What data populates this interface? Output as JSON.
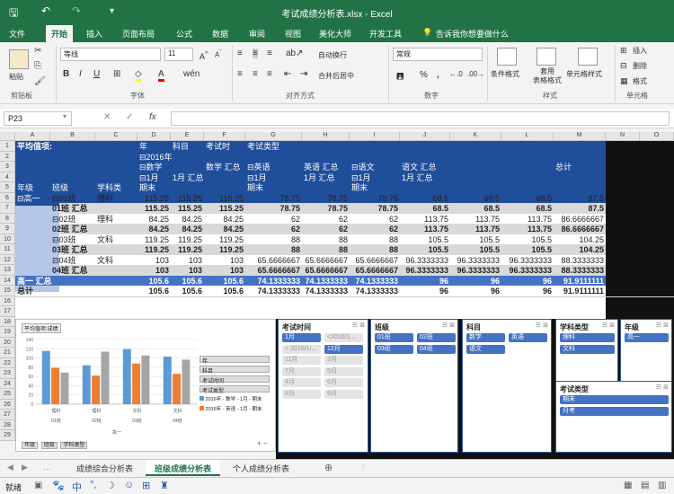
{
  "window": {
    "title": "考试成绩分析表.xlsx - Excel"
  },
  "ribbon_tabs": [
    "文件",
    "开始",
    "插入",
    "页面布局",
    "公式",
    "数据",
    "审阅",
    "视图",
    "美化大师",
    "开发工具"
  ],
  "tell_me": "告诉我你想要做什么",
  "ribbon": {
    "paste": "粘贴",
    "font_name": "等线",
    "font_size": "11",
    "wrap_text": "自动换行",
    "merge_center": "合并后居中",
    "number_format": "常规",
    "percent": "%",
    "cond_format": "条件格式",
    "table_format": "套用\n表格格式",
    "cell_style": "单元格样式",
    "insert": "插入",
    "delete": "删除",
    "format": "格式",
    "groups": [
      "剪贴板",
      "字体",
      "对齐方式",
      "数字",
      "样式",
      "单元格"
    ]
  },
  "formula_bar": {
    "name_box": "P23",
    "fx": "fx"
  },
  "columns": [
    "A",
    "B",
    "C",
    "D",
    "E",
    "F",
    "G",
    "H",
    "I",
    "J",
    "K",
    "L",
    "M",
    "N",
    "O"
  ],
  "rows": [
    "1",
    "2",
    "3",
    "4",
    "5",
    "6",
    "7",
    "8",
    "9",
    "10",
    "11",
    "12",
    "13",
    "14",
    "15",
    "16",
    "17",
    "18",
    "19",
    "20",
    "21",
    "22",
    "23",
    "24",
    "25",
    "26",
    "27",
    "28",
    "29"
  ],
  "pivot": {
    "r1": {
      "a": "平均值项:",
      "d": "年",
      "e": "科目",
      "f": "考试时",
      "g": "考试类型"
    },
    "r2": {
      "d": "⊟2016年"
    },
    "r3": {
      "d": "⊟数学",
      "f": "数学 汇总",
      "g": "⊟英语",
      "h": "英语 汇总",
      "i": "⊟语文",
      "j": "语文 汇总",
      "m": "总计"
    },
    "r4": {
      "d": "⊟1月",
      "e": "1月 汇总",
      "g": "⊟1月",
      "h": "1月 汇总",
      "i": "⊟1月",
      "j": "1月 汇总"
    },
    "r5": {
      "a": "年级",
      "b": "班级",
      "c": "学科类",
      "d": "期末",
      "g": "期末",
      "i": "期末"
    },
    "data": [
      {
        "a": "⊟高一",
        "b": "⊟01班",
        "c": "理科",
        "v": [
          "115.25",
          "115.25",
          "115.25",
          "78.75",
          "78.75",
          "78.75",
          "68.5",
          "68.5",
          "68.5",
          "87.5"
        ],
        "sum": false
      },
      {
        "a": "",
        "b": "01班 汇总",
        "c": "",
        "v": [
          "115.25",
          "115.25",
          "115.25",
          "78.75",
          "78.75",
          "78.75",
          "68.5",
          "68.5",
          "68.5",
          "87.5"
        ],
        "sum": true
      },
      {
        "a": "",
        "b": "⊟02班",
        "c": "理科",
        "v": [
          "84.25",
          "84.25",
          "84.25",
          "62",
          "62",
          "62",
          "113.75",
          "113.75",
          "113.75",
          "86.6666667"
        ],
        "sum": false
      },
      {
        "a": "",
        "b": "02班 汇总",
        "c": "",
        "v": [
          "84.25",
          "84.25",
          "84.25",
          "62",
          "62",
          "62",
          "113.75",
          "113.75",
          "113.75",
          "86.6666667"
        ],
        "sum": true
      },
      {
        "a": "",
        "b": "⊟03班",
        "c": "文科",
        "v": [
          "119.25",
          "119.25",
          "119.25",
          "88",
          "88",
          "88",
          "105.5",
          "105.5",
          "105.5",
          "104.25"
        ],
        "sum": false
      },
      {
        "a": "",
        "b": "03班 汇总",
        "c": "",
        "v": [
          "119.25",
          "119.25",
          "119.25",
          "88",
          "88",
          "88",
          "105.5",
          "105.5",
          "105.5",
          "104.25"
        ],
        "sum": true
      },
      {
        "a": "",
        "b": "⊟04班",
        "c": "文科",
        "v": [
          "103",
          "103",
          "103",
          "65.6666667",
          "65.6666667",
          "65.6666667",
          "96.3333333",
          "96.3333333",
          "96.3333333",
          "88.3333333"
        ],
        "sum": false
      },
      {
        "a": "",
        "b": "04班 汇总",
        "c": "",
        "v": [
          "103",
          "103",
          "103",
          "65.6666667",
          "65.6666667",
          "65.6666667",
          "96.3333333",
          "96.3333333",
          "96.3333333",
          "88.3333333"
        ],
        "sum": true
      },
      {
        "a": "高一 汇总",
        "b": "",
        "c": "",
        "v": [
          "105.6",
          "105.6",
          "105.6",
          "74.1333333",
          "74.1333333",
          "74.1333333",
          "96",
          "96",
          "96",
          "91.9111111"
        ],
        "sum": true,
        "band": true
      },
      {
        "a": "总计",
        "b": "",
        "c": "",
        "v": [
          "105.6",
          "105.6",
          "105.6",
          "74.1333333",
          "74.1333333",
          "74.1333333",
          "96",
          "96",
          "96",
          "91.9111111"
        ],
        "sum": true
      }
    ]
  },
  "chart": {
    "button_label": "平均值项:成绩",
    "bottom_buttons": [
      "年级",
      "班级",
      "学科类型"
    ],
    "fields": [
      "年",
      "科目",
      "考试时间",
      "考试类型"
    ],
    "legend": [
      "2016年 - 数学 - 1月 - 期末",
      "2016年 - 英语 - 1月 - 期末"
    ],
    "colors": [
      "#5b9bd5",
      "#ed7d31",
      "#a5a5a5"
    ]
  },
  "chart_data": {
    "type": "bar",
    "categories": [
      "理科 01班",
      "理科 02班",
      "文科 03班",
      "文科 04班"
    ],
    "x_groups": {
      "classes": [
        "01班",
        "02班",
        "03班",
        "04班"
      ],
      "subjects": [
        "理科",
        "理科",
        "文科",
        "文科"
      ],
      "grade": "高一"
    },
    "ylim": [
      0,
      140
    ],
    "yticks": [
      "0",
      "20",
      "40",
      "60",
      "80",
      "100",
      "120",
      "140"
    ],
    "series": [
      {
        "name": "2016年 - 数学 - 1月 - 期末",
        "values": [
          115.25,
          84.25,
          119.25,
          103
        ]
      },
      {
        "name": "2016年 - 英语 - 1月 - 期末",
        "values": [
          78.75,
          62,
          88,
          65.67
        ]
      },
      {
        "values": [
          68.5,
          113.75,
          105.5,
          96.33
        ]
      }
    ]
  },
  "slicers": {
    "time": {
      "title": "考试时间",
      "items": [
        "1月",
        "<2016/1...",
        "> 2016/1/...",
        "12月",
        "11月",
        "3月",
        "7月",
        "5月",
        "4月",
        "6月",
        "8月",
        "9月"
      ]
    },
    "class": {
      "title": "班级",
      "items": [
        "01班",
        "02班",
        "03班",
        "04班"
      ]
    },
    "subject": {
      "title": "科目",
      "items": [
        "数学",
        "英语",
        "语文"
      ]
    },
    "type": {
      "title": "学科类型",
      "items": [
        "理科",
        "文科"
      ]
    },
    "grade": {
      "title": "年级",
      "items": [
        "高一"
      ]
    },
    "exam": {
      "title": "考试类型",
      "items": [
        "期末",
        "月考"
      ]
    }
  },
  "sheets": [
    "成绩综合分析表",
    "班级成绩分析表",
    "个人成绩分析表"
  ],
  "status": {
    "ready": "就绪"
  }
}
